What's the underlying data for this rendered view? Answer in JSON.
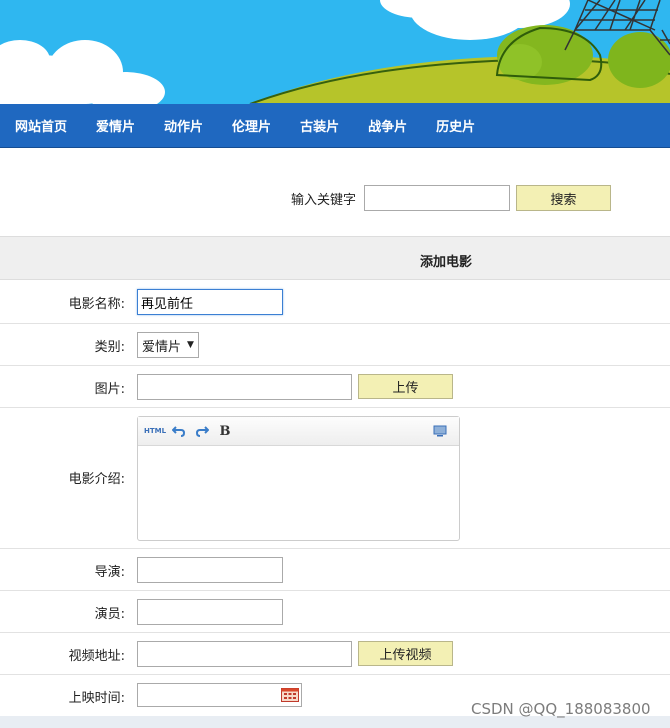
{
  "nav": {
    "items": [
      "网站首页",
      "爱情片",
      "动作片",
      "伦理片",
      "古装片",
      "战争片",
      "历史片"
    ]
  },
  "search": {
    "label": "输入关键字",
    "value": "",
    "button": "搜索"
  },
  "form": {
    "title": "添加电影",
    "name_label": "电影名称:",
    "name_value": "再见前任",
    "category_label": "类别:",
    "category_value": "爱情片",
    "image_label": "图片:",
    "image_value": "",
    "upload_button": "上传",
    "intro_label": "电影介绍:",
    "editor_html_label": "HTML",
    "editor_bold_label": "B",
    "director_label": "导演:",
    "director_value": "",
    "actor_label": "演员:",
    "actor_value": "",
    "video_label": "视频地址:",
    "video_value": "",
    "upload_video_button": "上传视频",
    "release_label": "上映时间:",
    "release_value": ""
  },
  "watermark": "CSDN @QQ_188083800",
  "colors": {
    "nav_bg": "#1f68c0",
    "button_bg": "#f3f0b4",
    "sky": "#2fb7f0",
    "grass": "#b6c42a"
  },
  "icons": [
    "undo-icon",
    "redo-icon",
    "bold-icon",
    "fullscreen-icon",
    "calendar-icon"
  ]
}
